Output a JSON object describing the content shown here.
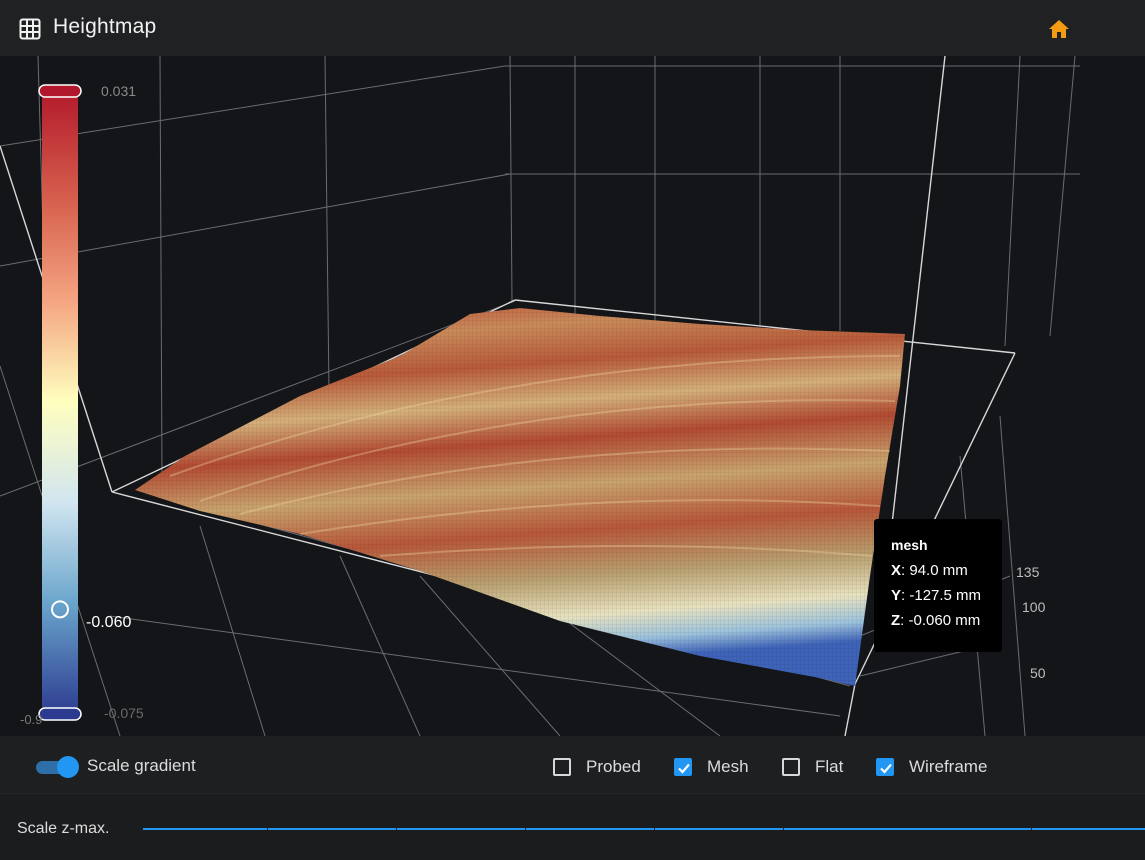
{
  "header": {
    "title": "Heightmap",
    "title_icon": "grid-icon",
    "home_icon": "home-icon",
    "accent": "#f39c12"
  },
  "colorbar": {
    "max_label": "0.031",
    "value_label": "-0.060",
    "min_label": "-0.075",
    "edge_label": "-0.9",
    "value_fraction": 0.168,
    "colors": [
      "#b2182b",
      "#ef8a62",
      "#fddbc7",
      "#ffffbf",
      "#d1e5f0",
      "#67a9cf",
      "#2c3a8f"
    ]
  },
  "axis_ticks": [
    "135",
    "100",
    "50"
  ],
  "tooltip": {
    "title": "mesh",
    "x_key": "X",
    "x_val": ": 94.0 mm",
    "y_key": "Y",
    "y_val": ": -127.5 mm",
    "z_key": "Z",
    "z_val": ": -0.060 mm"
  },
  "controls": {
    "scale_gradient": {
      "label": "Scale gradient",
      "on": true
    },
    "probed": {
      "label": "Probed",
      "checked": false
    },
    "mesh": {
      "label": "Mesh",
      "checked": true
    },
    "flat": {
      "label": "Flat",
      "checked": false
    },
    "wireframe": {
      "label": "Wireframe",
      "checked": true
    },
    "accent": "#2196f3"
  },
  "scale_zmax": {
    "label": "Scale z-max.",
    "value": 1.0
  }
}
